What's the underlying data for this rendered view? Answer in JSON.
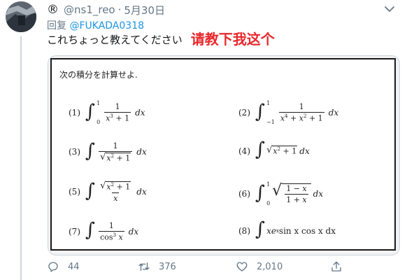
{
  "tweet": {
    "registered_mark": "®",
    "handle": "@ns1_reo",
    "separator": "·",
    "date": "5月30日",
    "reply_label": "回复",
    "reply_mention": "@FUKADA0318",
    "text": "これちょっと教えてください",
    "annotation": "请教下我这个",
    "annotation_color": "#e8282c"
  },
  "problem_sheet": {
    "title": "次の積分を計算せよ.",
    "labels": [
      "(1)",
      "(2)",
      "(3)",
      "(4)",
      "(5)",
      "(6)",
      "(7)",
      "(8)"
    ],
    "integrand_8": "xe",
    "integrand_8_exp": "x",
    "integrand_8_rest": " sin x cos x dx",
    "dx": "dx"
  },
  "actions": {
    "reply_count": "44",
    "retweet_count": "376",
    "like_count": "2,010"
  },
  "icons": [
    "chevron-down-icon",
    "reply-icon",
    "retweet-icon",
    "like-icon",
    "share-icon"
  ],
  "accent_color": "#1b95e0"
}
